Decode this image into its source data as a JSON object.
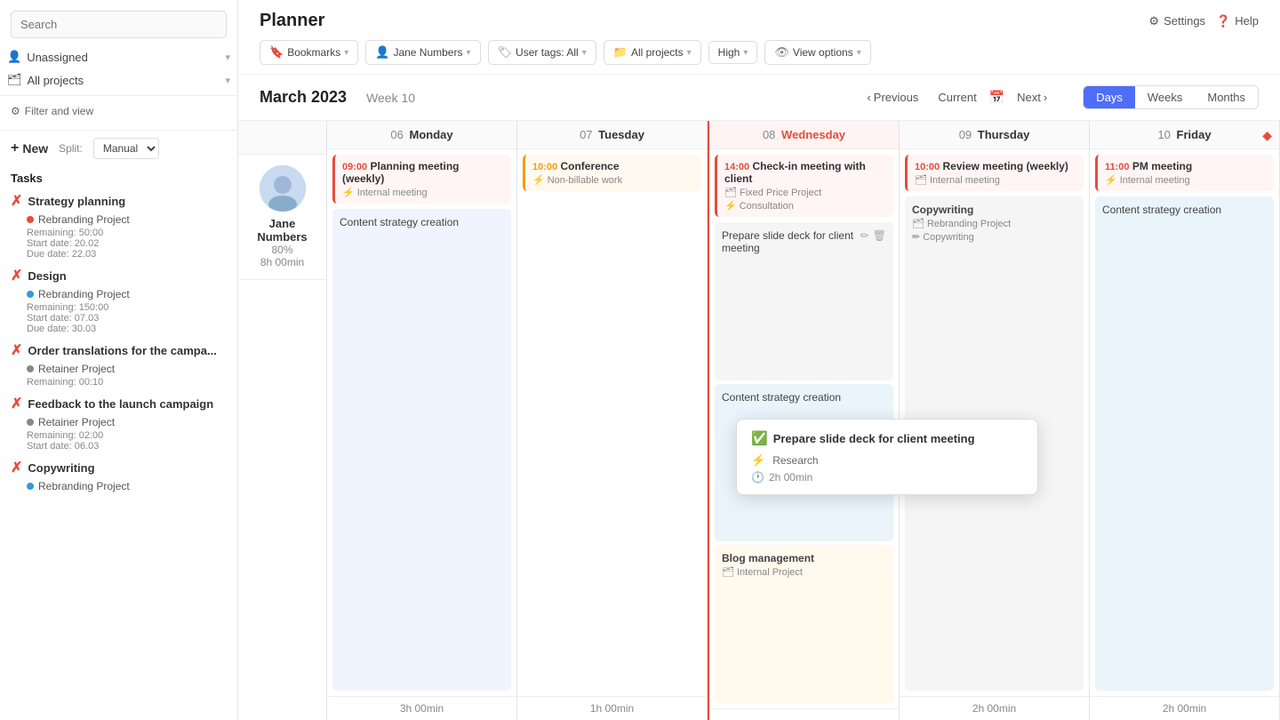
{
  "sidebar": {
    "search_placeholder": "Search",
    "unassigned_label": "Unassigned",
    "all_projects_label": "All projects",
    "filter_view_label": "Filter and view",
    "new_btn": "New",
    "split_label": "Split:",
    "split_value": "Manual",
    "tasks_header": "Tasks",
    "task_groups": [
      {
        "title": "Strategy planning",
        "project": "Rebranding Project",
        "project_color": "#e74c3c",
        "remaining": "Remaining: 50:00",
        "start": "Start date: 20.02",
        "due": "Due date: 22.03"
      },
      {
        "title": "Design",
        "project": "Rebranding Project",
        "project_color": "#3498db",
        "remaining": "Remaining: 150:00",
        "start": "Start date: 07.03",
        "due": "Due date: 30.03"
      },
      {
        "title": "Order translations for the campa...",
        "project": "Retainer Project",
        "project_color": "#888",
        "remaining": "Remaining: 00:10"
      },
      {
        "title": "Feedback to the launch campaign",
        "project": "Retainer Project",
        "project_color": "#888",
        "remaining": "Remaining: 02:00",
        "start": "Start date: 06.03"
      },
      {
        "title": "Copywriting",
        "project": "Rebranding Project",
        "project_color": "#3498db"
      }
    ]
  },
  "header": {
    "title": "Planner",
    "settings_label": "Settings",
    "help_label": "Help"
  },
  "toolbar": {
    "bookmarks_label": "Bookmarks",
    "user_label": "Jane Numbers",
    "user_tags_label": "User tags: All",
    "all_projects_label": "All projects",
    "high_label": "High",
    "view_options_label": "View options"
  },
  "calendar": {
    "month": "March 2023",
    "week": "Week 10",
    "prev_label": "Previous",
    "current_label": "Current",
    "next_label": "Next",
    "view_days": "Days",
    "view_weeks": "Weeks",
    "view_months": "Months",
    "avatar_name": "Jane Numbers",
    "avatar_pct": "80%",
    "avatar_time": "8h 00min",
    "days": [
      {
        "num": "06",
        "name": "Monday"
      },
      {
        "num": "07",
        "name": "Tuesday"
      },
      {
        "num": "08",
        "name": "Wednesday"
      },
      {
        "num": "09",
        "name": "Thursday"
      },
      {
        "num": "10",
        "name": "Friday"
      }
    ],
    "footers": [
      "3h 00min",
      "1h 00min",
      "",
      "2h 00min",
      "2h 00min"
    ],
    "monday_events": [
      {
        "time": "09:00",
        "title": "Planning meeting (weekly)",
        "sub": "Internal meeting",
        "type": "red"
      }
    ],
    "monday_tasks": [
      "Content strategy creation"
    ],
    "tuesday_events": [
      {
        "time": "10:00",
        "title": "Conference",
        "sub": "Non-billable work",
        "type": "orange"
      }
    ],
    "wednesday_events": [
      {
        "time": "14:00",
        "title": "Check-in meeting with client",
        "sub1": "Fixed Price Project",
        "sub2": "Consultation",
        "type": "red"
      }
    ],
    "wednesday_tasks": [
      {
        "title": "Prepare slide deck for client meeting",
        "sub": "Research"
      },
      {
        "title": "Content strategy creation"
      },
      {
        "title": "Blog management",
        "project": "Internal Project"
      }
    ],
    "thursday_events": [
      {
        "time": "10:00",
        "title": "Review meeting (weekly)",
        "sub": "Internal meeting",
        "type": "red"
      }
    ],
    "thursday_tasks": [
      {
        "title": "Copywriting",
        "project": "Rebranding Project",
        "sub": "Copywriting"
      }
    ],
    "friday_events": [
      {
        "time": "11:00",
        "title": "PM meeting",
        "sub": "Internal meeting",
        "type": "red"
      }
    ],
    "friday_tasks": [
      {
        "title": "Content strategy creation"
      }
    ]
  },
  "popup": {
    "title": "Prepare slide deck for client meeting",
    "task_type": "Research",
    "time": "2h 00min"
  }
}
